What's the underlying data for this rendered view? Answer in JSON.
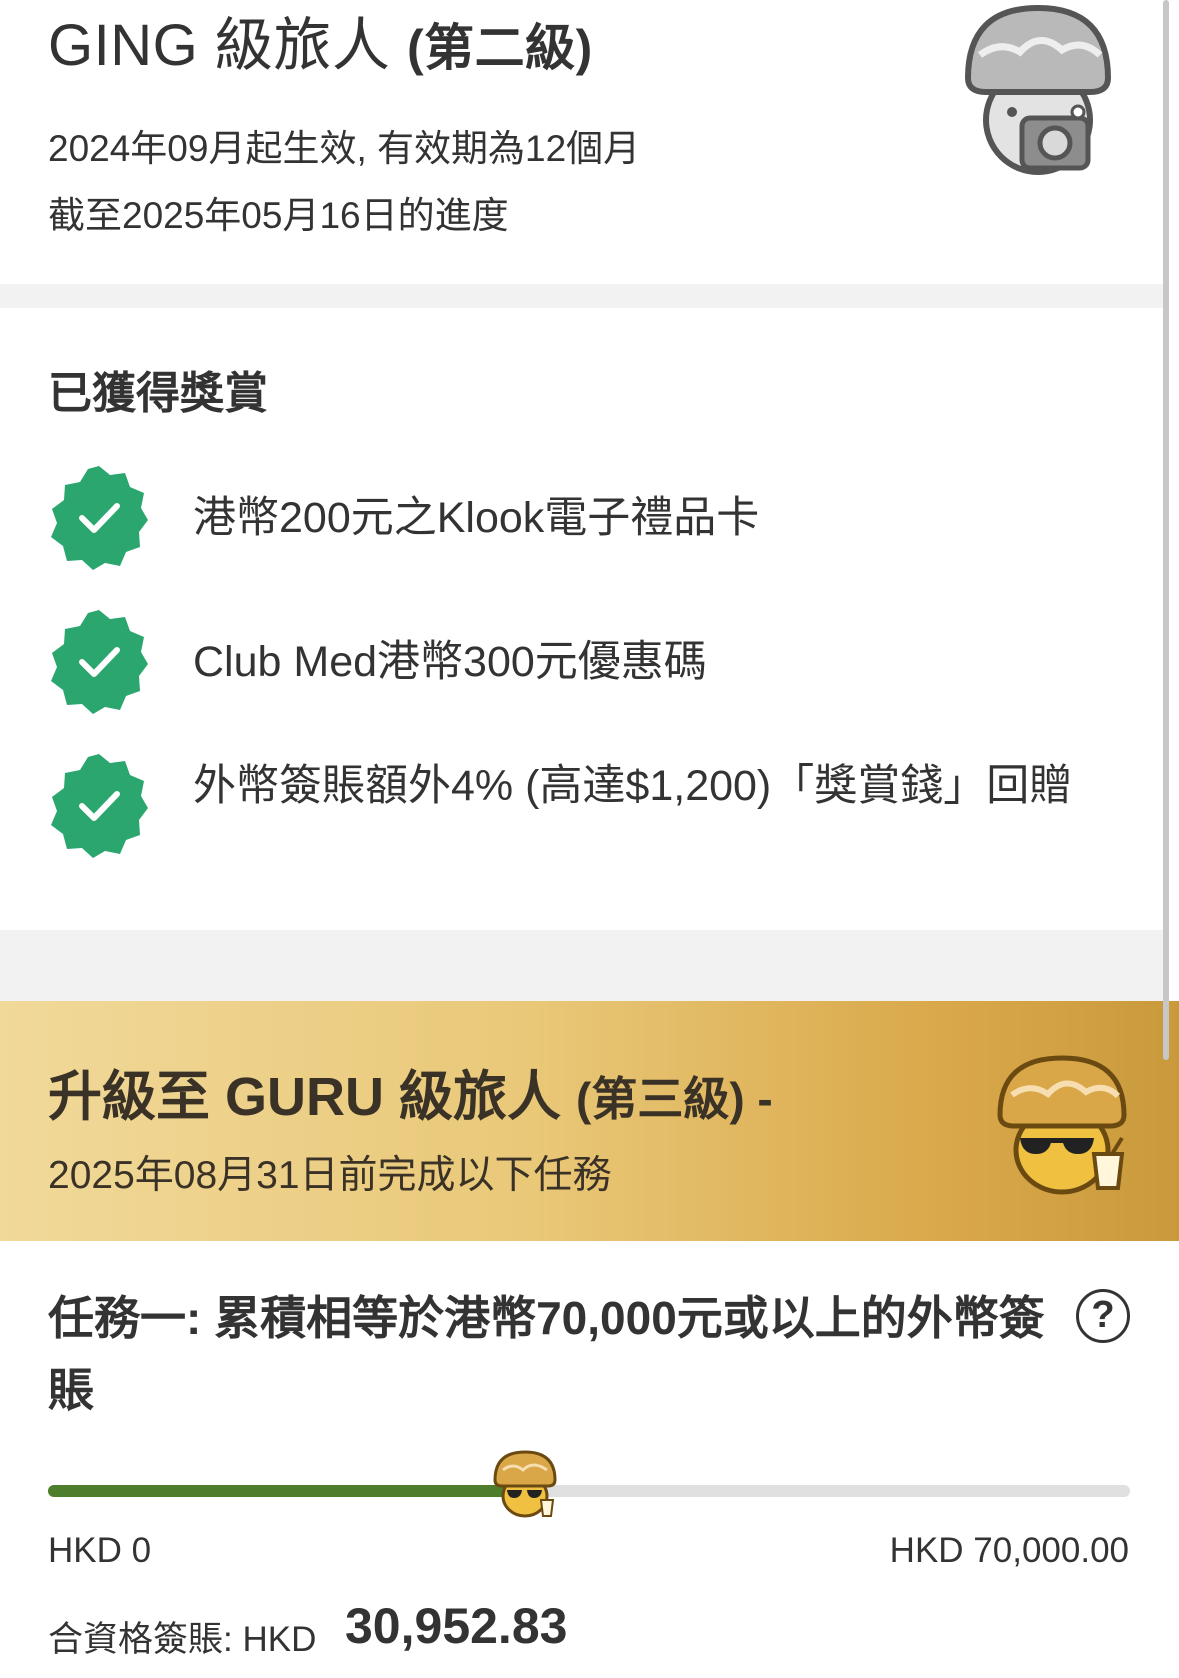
{
  "tier": {
    "title": "GING 級旅人",
    "level": "(第二級)",
    "validity": "2024年09月起生效, 有效期為12個月",
    "progress_as_of": "截至2025年05月16日的進度"
  },
  "rewards": {
    "heading": "已獲得獎賞",
    "items": [
      {
        "text": "港幣200元之Klook電子禮品卡"
      },
      {
        "text": "Club Med港幣300元優惠碼"
      },
      {
        "text": "外幣簽賬額外4% (高達$1,200)「獎賞錢」回贈"
      }
    ]
  },
  "upgrade": {
    "title": "升級至 GURU 級旅人",
    "level": "(第三級) -",
    "deadline": "2025年08月31日前完成以下任務"
  },
  "task": {
    "text": "任務一: 累積相等於港幣70,000元或以上的外幣簽賬",
    "help_icon": "question-circle-icon",
    "help_glyph": "?",
    "progress_fraction": 0.4422,
    "scale_min": "HKD 0",
    "scale_max": "HKD 70,000.00",
    "eligible_label": "合資格簽賬: HKD",
    "eligible_value": "30,952.83"
  },
  "colors": {
    "check_badge": "#2aa66e",
    "progress_fill": "#4e7e2c",
    "banner_gold": "#d9a84a"
  }
}
